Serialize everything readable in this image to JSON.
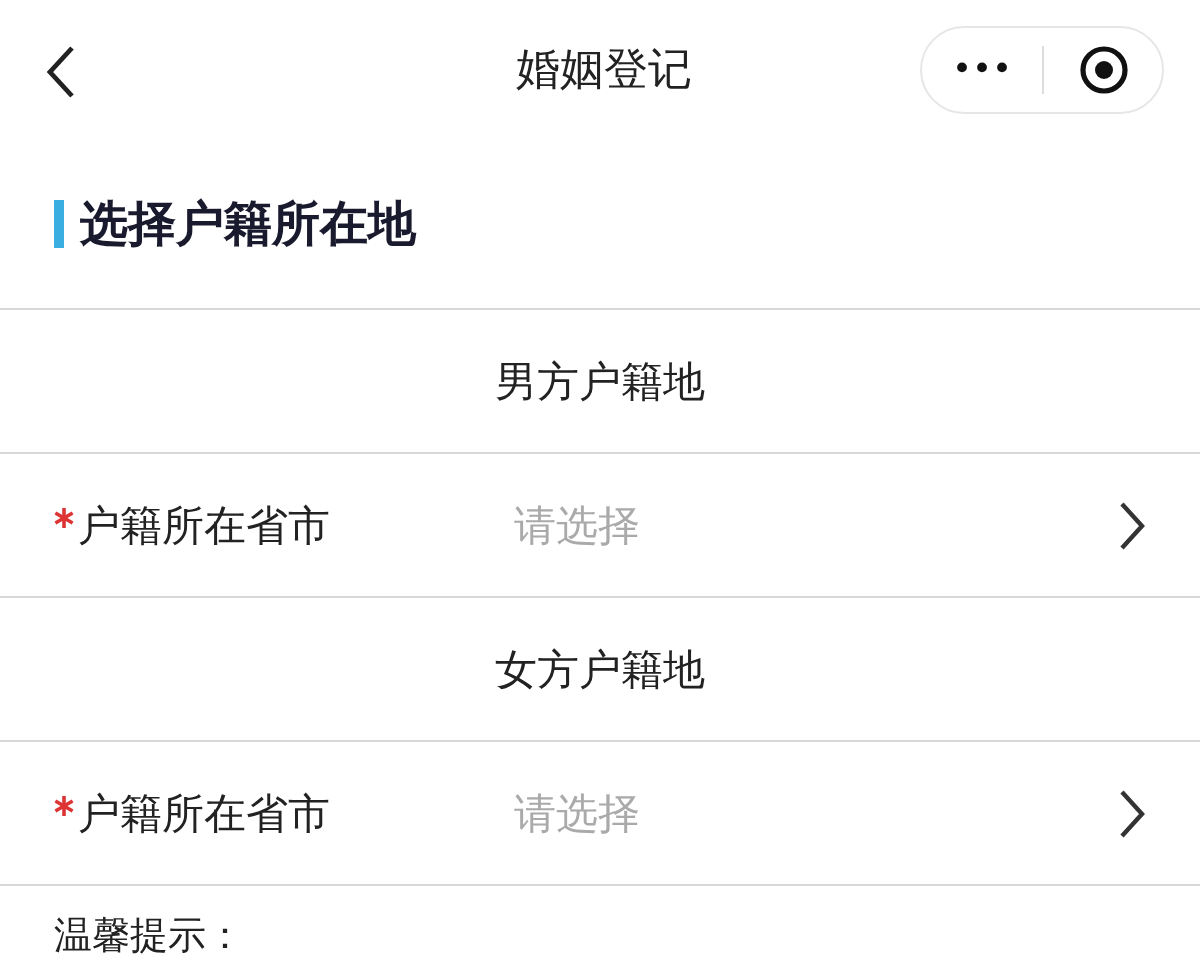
{
  "nav": {
    "title": "婚姻登记",
    "more_button": "•••"
  },
  "section_title": "选择户籍所在地",
  "rows": [
    {
      "kind": "heading",
      "text": "男方户籍地"
    },
    {
      "kind": "field",
      "label": "户籍所在省市",
      "required": true,
      "placeholder": "请选择"
    },
    {
      "kind": "heading",
      "text": "女方户籍地"
    },
    {
      "kind": "field",
      "label": "户籍所在省市",
      "required": true,
      "placeholder": "请选择"
    }
  ],
  "tip": "温馨提示："
}
